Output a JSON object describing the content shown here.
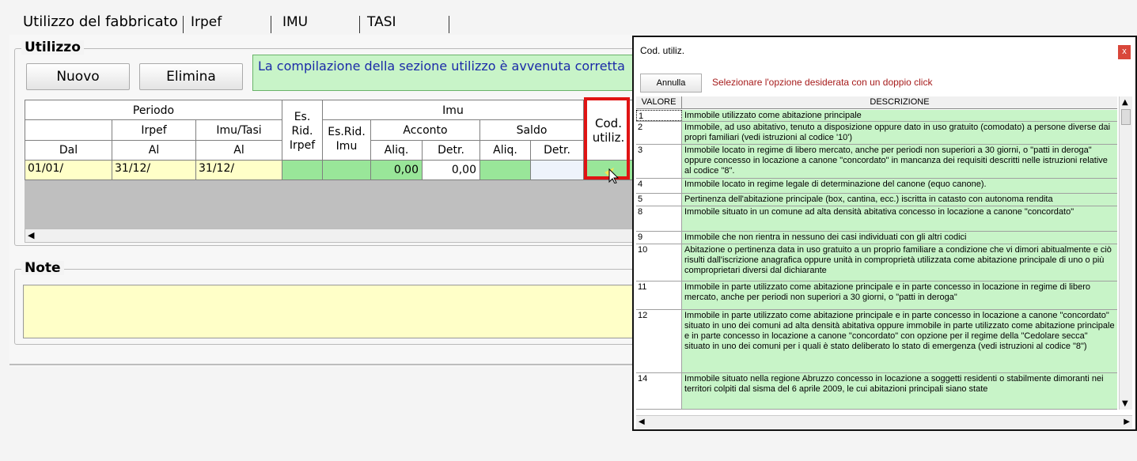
{
  "tabs": [
    {
      "label": "Utilizzo del fabbricato"
    },
    {
      "label": "Irpef"
    },
    {
      "label": "IMU"
    },
    {
      "label": "TASI"
    }
  ],
  "utilizzo": {
    "title": "Utilizzo",
    "new_label": "Nuovo",
    "delete_label": "Elimina",
    "message": "La compilazione della sezione utilizzo è avvenuta corretta"
  },
  "grid": {
    "headers": {
      "periodo": "Periodo",
      "irpef": "Irpef",
      "imu_tasi": "Imu/Tasi",
      "dal": "Dal",
      "al_irpef": "Al",
      "al_imu": "Al",
      "es_rid_irpef": "Es. Rid. Irpef",
      "imu": "Imu",
      "es_rid_imu": "Es.Rid. Imu",
      "acconto": "Acconto",
      "saldo": "Saldo",
      "aliq1": "Aliq.",
      "detr1": "Detr.",
      "aliq2": "Aliq.",
      "detr2": "Detr.",
      "cod_utiliz": "Cod. utiliz."
    },
    "row": {
      "dal": "01/01/",
      "al_irpef": "31/12/",
      "al_imu": "31/12/",
      "acconto_aliq": "0,00",
      "acconto_detr": "0,00"
    }
  },
  "notes": {
    "title": "Note"
  },
  "dialog": {
    "title": "Cod. utiliz.",
    "close_label": "x",
    "cancel_label": "Annulla",
    "hint": "Selezionare l'opzione desiderata con un doppio click",
    "col_value": "VALORE",
    "col_desc": "DESCRIZIONE",
    "items": [
      {
        "value": "1",
        "desc": "Immobile utilizzato come abitazione principale"
      },
      {
        "value": "2",
        "desc": "Immobile, ad uso abitativo, tenuto a disposizione oppure dato in uso gratuito (comodato) a persone diverse dai propri familiari (vedi istruzioni al codice '10')"
      },
      {
        "value": "3",
        "desc": "Immobile locato in regime di libero mercato, anche per periodi non superiori a 30 giorni, o \"patti in deroga\" oppure concesso in locazione a canone \"concordato\" in mancanza dei requisiti descritti nelle istruzioni relative al codice \"8\"."
      },
      {
        "value": "4",
        "desc": "Immobile locato in regime legale di determinazione del canone (equo canone)."
      },
      {
        "value": "5",
        "desc": "Pertinenza dell'abitazione principale (box, cantina, ecc.) iscritta in catasto con autonoma rendita"
      },
      {
        "value": "8",
        "desc": "Immobile situato in un comune ad alta densità abitativa concesso in locazione a canone \"concordato\""
      },
      {
        "value": "9",
        "desc": "Immobile che non rientra in nessuno dei casi individuati con gli altri codici"
      },
      {
        "value": "10",
        "desc": "Abitazione o pertinenza data in uso gratuito a un proprio familiare a condizione che vi dimori abitualmente e ciò risulti dall'iscrizione anagrafica oppure unità in comproprietà utilizzata come abitazione principale di uno o più comproprietari diversi dal dichiarante"
      },
      {
        "value": "11",
        "desc": "Immobile in parte utilizzato come abitazione principale e in parte concesso in locazione in regime di libero mercato, anche per periodi non superiori a 30 giorni, o \"patti in deroga\""
      },
      {
        "value": "12",
        "desc": "Immobile in parte utilizzato come abitazione principale e in parte concesso in locazione a canone \"concordato\" situato in uno dei comuni ad alta densità abitativa oppure immobile in parte utilizzato come abitazione principale e in parte concesso in locazione a canone \"concordato\" con opzione per il regime della \"Cedolare secca\" situato in uno dei comuni per i quali è stato deliberato lo stato di emergenza (vedi istruzioni al codice \"8\")"
      },
      {
        "value": "14",
        "desc": "Immobile situato nella regione Abruzzo concesso in locazione a soggetti residenti o stabilmente dimoranti nei territori colpiti dal sisma del 6 aprile 2009, le cui abitazioni principali siano state"
      }
    ]
  },
  "colors": {
    "accent_green": "#99e699",
    "message_bg": "#c8f4c8",
    "yellow": "#ffffc8",
    "highlight": "#e01414"
  }
}
